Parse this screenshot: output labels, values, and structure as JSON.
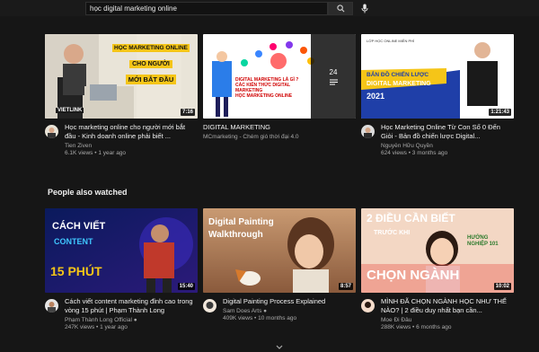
{
  "search": {
    "query": "học digital marketing online"
  },
  "icons": {
    "search": "search-icon",
    "mic": "microphone-icon",
    "expand": "chevron-down-icon"
  },
  "colors": {
    "background": "#161616",
    "accent_yellow": "#f5c518",
    "accent_blue": "#1f3fa8"
  },
  "row1": [
    {
      "thumb_text": [
        "HỌC MARKETING ONLINE",
        "CHO NGƯỜI",
        "MỚI BẮT ĐẦU"
      ],
      "brand": "VIETLINK",
      "duration": "7:16",
      "title": "Học marketing online cho người mới bắt đầu - Kinh doanh online phải biết ...",
      "channel": "Tien Ziven",
      "stats": "6.1K views • 1 year ago"
    },
    {
      "thumb_text": [
        "DIGITAL MARKETING LÀ GÌ ?",
        "CÁC KIẾN THỨC DIGITAL MARKETING",
        "HỌC MARKETING ONLINE"
      ],
      "playlist_count": "24",
      "title": "DIGITAL MARKETING",
      "channel": "MCmarketing - Chém gió thời đại 4.0",
      "stats": ""
    },
    {
      "thumb_text": [
        "LỚP HỌC ONLINE MIỄN PHÍ",
        "BẢN ĐỒ CHIẾN LƯỢC",
        "DIGITAL MARKETING",
        "2021"
      ],
      "duration": "1:21:43",
      "title": "Học Marketing Online Từ Con Số 0 Đến Giỏi - Bản đồ chiến lược Digital...",
      "channel": "Nguyễn Hữu Quyền",
      "stats": "624 views • 3 months ago"
    }
  ],
  "section_title": "People also watched",
  "row2": [
    {
      "thumb_text": [
        "CÁCH VIẾT",
        "CONTENT",
        "15 PHÚT"
      ],
      "duration": "15:40",
      "title": "Cách viết content marketing đỉnh cao trong vòng 15 phút | Phạm Thành Long",
      "channel": "Phạm Thành Long Official ●",
      "stats": "247K views • 1 year ago"
    },
    {
      "thumb_text": [
        "Digital Painting",
        "Walkthrough"
      ],
      "duration": "8:57",
      "title": "Digital Painting Process Explained",
      "channel": "Sam Does Arts ●",
      "stats": "409K views • 10 months ago"
    },
    {
      "thumb_text": [
        "2 ĐIỀU CẦN BIẾT",
        "TRƯỚC KHI",
        "CHỌN NGÀNH",
        "HƯỚNG NGHIỆP 101"
      ],
      "duration": "10:02",
      "title": "MÌNH ĐÃ CHỌN NGÀNH HỌC NHƯ THẾ NÀO? | 2 điều duy nhất bạn cần...",
      "channel": "Moe Đi Đâu",
      "stats": "288K views • 6 months ago"
    }
  ]
}
